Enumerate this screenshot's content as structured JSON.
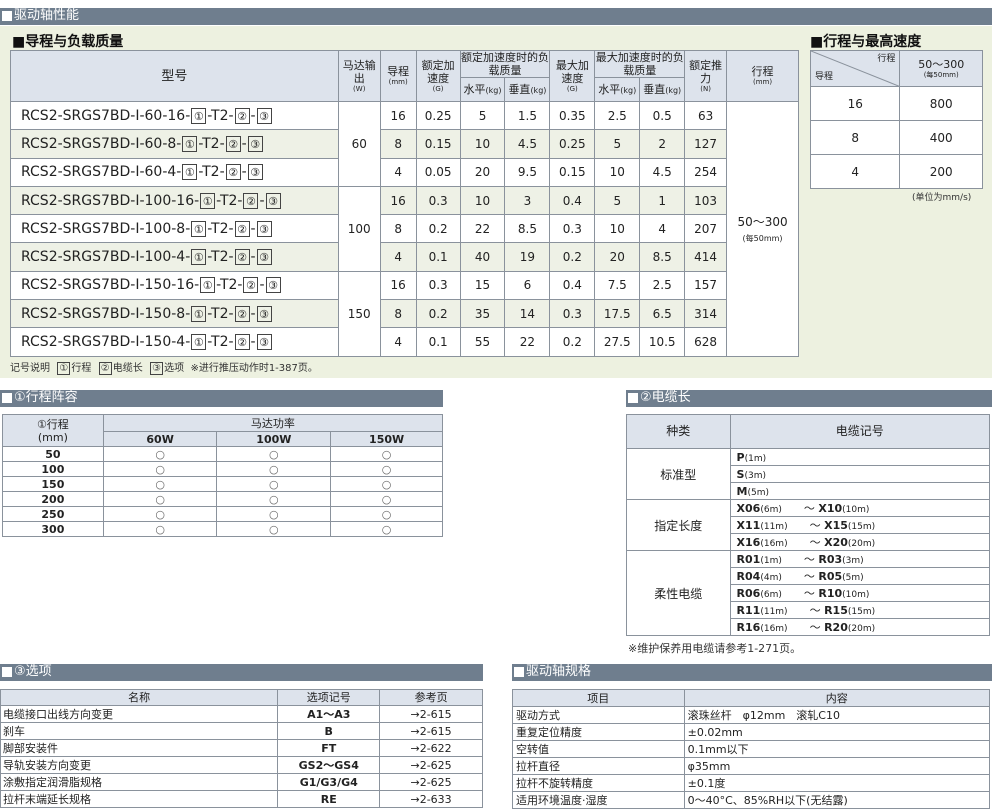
{
  "main_title": "驱动轴性能",
  "load": {
    "title": "■导程与负载质量",
    "headers": {
      "model": "型号",
      "motor": "马达输出",
      "motor_unit": "(W)",
      "lead": "导程",
      "lead_unit": "(mm)",
      "rated_acc": "额定加速度",
      "acc_unit": "(G)",
      "rated_load": "额定加速度时的负载质量",
      "horiz": "水平",
      "kg": "(kg)",
      "vert": "垂直",
      "max_acc": "最大加速度",
      "max_load": "最大加速度时的负载质量",
      "thrust": "额定推力",
      "thrust_unit": "(N)",
      "stroke": "行程",
      "stroke_unit": "(mm)"
    },
    "box1": "①",
    "box2": "②",
    "box3": "③",
    "rows": [
      {
        "model": "RCS2-SRGS7BD-I-60-16-",
        "lead": "16",
        "ra": "0.25",
        "rh": "5",
        "rv": "1.5",
        "ma": "0.35",
        "mh": "2.5",
        "mv": "0.5",
        "f": "63"
      },
      {
        "model": "RCS2-SRGS7BD-I-60-8-",
        "lead": "8",
        "ra": "0.15",
        "rh": "10",
        "rv": "4.5",
        "ma": "0.25",
        "mh": "5",
        "mv": "2",
        "f": "127"
      },
      {
        "model": "RCS2-SRGS7BD-I-60-4-",
        "lead": "4",
        "ra": "0.05",
        "rh": "20",
        "rv": "9.5",
        "ma": "0.15",
        "mh": "10",
        "mv": "4.5",
        "f": "254"
      },
      {
        "model": "RCS2-SRGS7BD-I-100-16-",
        "lead": "16",
        "ra": "0.3",
        "rh": "10",
        "rv": "3",
        "ma": "0.4",
        "mh": "5",
        "mv": "1",
        "f": "103"
      },
      {
        "model": "RCS2-SRGS7BD-I-100-8-",
        "lead": "8",
        "ra": "0.2",
        "rh": "22",
        "rv": "8.5",
        "ma": "0.3",
        "mh": "10",
        "mv": "4",
        "f": "207"
      },
      {
        "model": "RCS2-SRGS7BD-I-100-4-",
        "lead": "4",
        "ra": "0.1",
        "rh": "40",
        "rv": "19",
        "ma": "0.2",
        "mh": "20",
        "mv": "8.5",
        "f": "414"
      },
      {
        "model": "RCS2-SRGS7BD-I-150-16-",
        "lead": "16",
        "ra": "0.3",
        "rh": "15",
        "rv": "6",
        "ma": "0.4",
        "mh": "7.5",
        "mv": "2.5",
        "f": "157"
      },
      {
        "model": "RCS2-SRGS7BD-I-150-8-",
        "lead": "8",
        "ra": "0.2",
        "rh": "35",
        "rv": "14",
        "ma": "0.3",
        "mh": "17.5",
        "mv": "6.5",
        "f": "314"
      },
      {
        "model": "RCS2-SRGS7BD-I-150-4-",
        "lead": "4",
        "ra": "0.1",
        "rh": "55",
        "rv": "22",
        "ma": "0.2",
        "mh": "27.5",
        "mv": "10.5",
        "f": "628"
      }
    ],
    "motors": [
      "60",
      "100",
      "150"
    ],
    "stroke": "50〜300",
    "stroke_sub": "(每50mm)",
    "note": {
      "label": "记号说明",
      "s1": "行程",
      "s2": "电缆长",
      "s3": "选项",
      "ref": "※进行推压动作时1-387页。"
    }
  },
  "speed": {
    "title": "■行程与最高速度",
    "h_stroke": "行程",
    "h_lead": "导程",
    "h_range": "50〜300",
    "h_range_sub": "(每50mm)",
    "rows": [
      {
        "lead": "16",
        "speed": "800"
      },
      {
        "lead": "8",
        "speed": "400"
      },
      {
        "lead": "4",
        "speed": "200"
      }
    ],
    "unit": "(单位为mm/s)"
  },
  "strokes": {
    "title": "①行程阵容",
    "h_stroke": "①行程",
    "h_mm": "(mm)",
    "h_motor": "马达功率",
    "cols": [
      "60W",
      "100W",
      "150W"
    ],
    "mark": "○",
    "rows": [
      "50",
      "100",
      "150",
      "200",
      "250",
      "300"
    ]
  },
  "cable": {
    "title": "②电缆长",
    "h_type": "种类",
    "h_code": "电缆记号",
    "groups": [
      {
        "type": "标准型",
        "items": [
          {
            "c1": "P",
            "u1": "(1m)"
          },
          {
            "c1": "S",
            "u1": "(3m)"
          },
          {
            "c1": "M",
            "u1": "(5m)"
          }
        ]
      },
      {
        "type": "指定长度",
        "items": [
          {
            "c1": "X06",
            "u1": "(6m)",
            "c2": "X10",
            "u2": "(10m)"
          },
          {
            "c1": "X11",
            "u1": "(11m)",
            "c2": "X15",
            "u2": "(15m)"
          },
          {
            "c1": "X16",
            "u1": "(16m)",
            "c2": "X20",
            "u2": "(20m)"
          }
        ]
      },
      {
        "type": "柔性电缆",
        "items": [
          {
            "c1": "R01",
            "u1": "(1m)",
            "c2": "R03",
            "u2": "(3m)"
          },
          {
            "c1": "R04",
            "u1": "(4m)",
            "c2": "R05",
            "u2": "(5m)"
          },
          {
            "c1": "R06",
            "u1": "(6m)",
            "c2": "R10",
            "u2": "(10m)"
          },
          {
            "c1": "R11",
            "u1": "(11m)",
            "c2": "R15",
            "u2": "(15m)"
          },
          {
            "c1": "R16",
            "u1": "(16m)",
            "c2": "R20",
            "u2": "(20m)"
          }
        ]
      }
    ],
    "tilde": "〜",
    "note": "※维护保养用电缆请参考1-271页。"
  },
  "options": {
    "title": "③选项",
    "headers": [
      "名称",
      "选项记号",
      "参考页"
    ],
    "rows": [
      {
        "name": "电缆接口出线方向变更",
        "code": "A1〜A3",
        "page": "→2-615"
      },
      {
        "name": "刹车",
        "code": "B",
        "page": "→2-615"
      },
      {
        "name": "脚部安装件",
        "code": "FT",
        "page": "→2-622"
      },
      {
        "name": "导轨安装方向变更",
        "code": "GS2〜GS4",
        "page": "→2-625"
      },
      {
        "name": "涂敷指定润滑脂规格",
        "code": "G1/G3/G4",
        "page": "→2-625"
      },
      {
        "name": "拉杆末端延长规格",
        "code": "RE",
        "page": "→2-633"
      }
    ]
  },
  "spec": {
    "title": "驱动轴规格",
    "headers": [
      "项目",
      "内容"
    ],
    "rows": [
      {
        "item": "驱动方式",
        "value": "滚珠丝杆　φ12mm　滚轧C10"
      },
      {
        "item": "重复定位精度",
        "value": "±0.02mm"
      },
      {
        "item": "空转值",
        "value": "0.1mm以下"
      },
      {
        "item": "拉杆直径",
        "value": "φ35mm"
      },
      {
        "item": "拉杆不旋转精度",
        "value": "±0.1度"
      },
      {
        "item": "适用环境温度·湿度",
        "value": "0〜40°C、85%RH以下(无结露)"
      }
    ]
  }
}
